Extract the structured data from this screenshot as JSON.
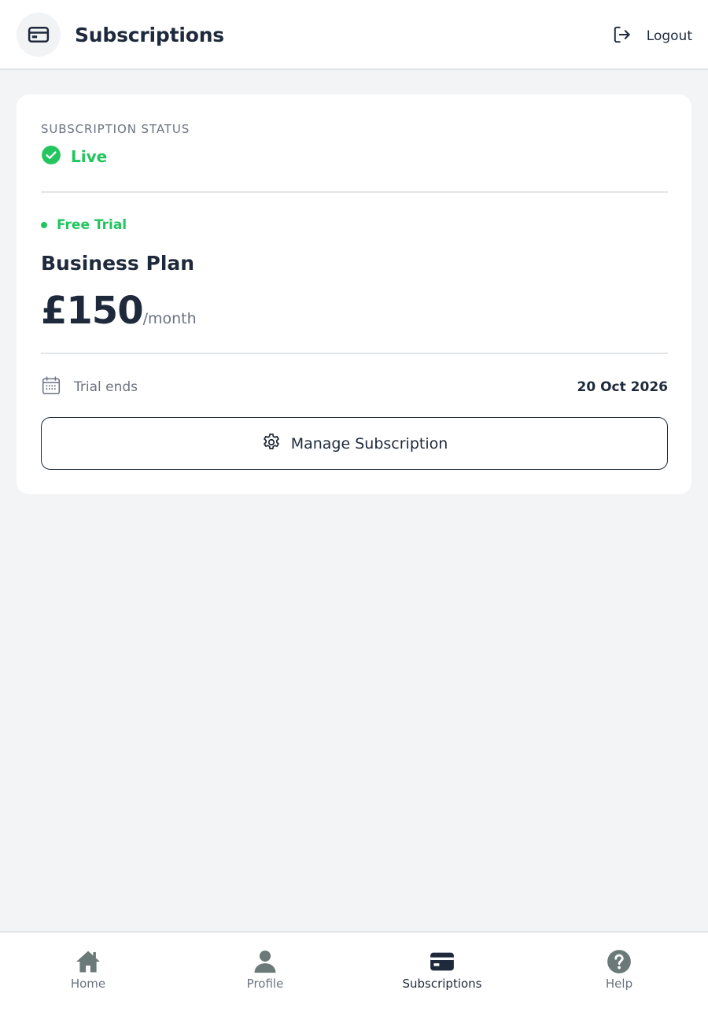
{
  "header": {
    "title": "Subscriptions",
    "icon": "credit-card-icon",
    "logout_label": "Logout",
    "logout_icon": "logout-icon"
  },
  "subscription": {
    "status_label": "SUBSCRIPTION STATUS",
    "status": "Live",
    "status_icon": "check-circle-icon",
    "trial_badge": "Free Trial",
    "plan_name": "Business Plan",
    "price": "£150",
    "period": "/month",
    "trial_ends_label": "Trial ends",
    "trial_ends_date": "20 Oct 2026",
    "calendar_icon": "calendar-icon",
    "manage_button_label": "Manage Subscription",
    "manage_button_icon": "gear-icon"
  },
  "nav": {
    "items": [
      {
        "label": "Home",
        "icon": "home-icon",
        "active": false
      },
      {
        "label": "Profile",
        "icon": "user-icon",
        "active": false
      },
      {
        "label": "Subscriptions",
        "icon": "credit-card-icon",
        "active": true
      },
      {
        "label": "Help",
        "icon": "help-icon",
        "active": false
      }
    ]
  },
  "colors": {
    "accent_green": "#22c55e",
    "text_dark": "#1e293b",
    "text_muted": "#6b7280",
    "background": "#f3f4f6",
    "nav_inactive_icon": "#6b7a78"
  }
}
